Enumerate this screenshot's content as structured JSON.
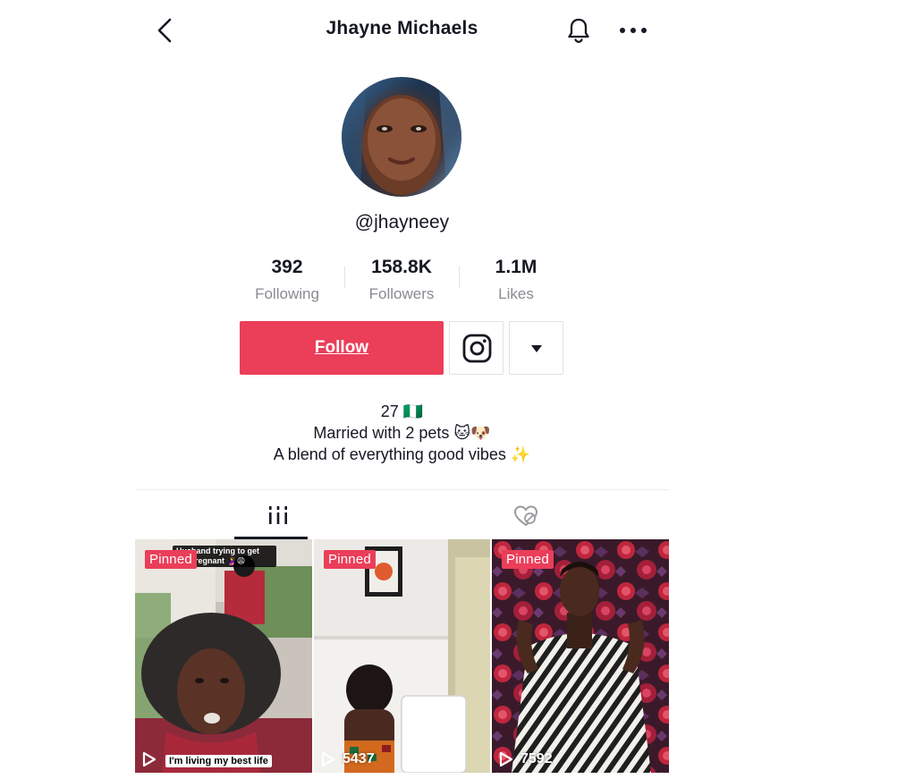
{
  "header": {
    "title": "Jhayne Michaels",
    "back_icon": "chevron-left-icon",
    "bell_icon": "bell-icon",
    "more_icon": "more-horizontal-icon"
  },
  "profile": {
    "username": "@jhayneey",
    "stats": [
      {
        "value": "392",
        "label": "Following"
      },
      {
        "value": "158.8K",
        "label": "Followers"
      },
      {
        "value": "1.1M",
        "label": "Likes"
      }
    ],
    "bio": [
      "27 🇳🇬",
      "Married with 2 pets 🐱🐶",
      "A blend of everything good vibes ✨"
    ]
  },
  "actions": {
    "follow_label": "Follow",
    "instagram_icon": "instagram-icon",
    "dropdown_icon": "caret-down-icon"
  },
  "tabs": [
    {
      "name": "videos",
      "icon": "grid-bars-icon",
      "active": true
    },
    {
      "name": "liked",
      "icon": "liked-hidden-icon",
      "active": false
    }
  ],
  "videos": [
    {
      "badge": "Pinned",
      "caption": "I'm living my best life",
      "overlay_text": "Husband trying to get me pregnant 🤰😩",
      "views": ""
    },
    {
      "badge": "Pinned",
      "views": "5437"
    },
    {
      "badge": "Pinned",
      "views": "7592"
    }
  ],
  "colors": {
    "accent": "#ea3e59",
    "text": "#161823",
    "muted": "#8a8b91"
  }
}
